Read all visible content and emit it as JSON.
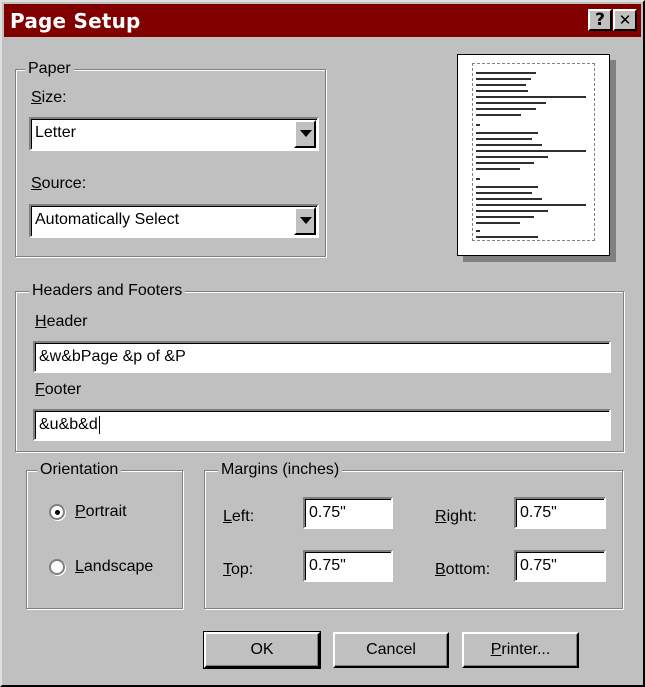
{
  "window": {
    "title": "Page Setup",
    "help_glyph": "?",
    "close_glyph": "✕"
  },
  "paper": {
    "legend": "Paper",
    "size_label": "Size:",
    "size_value": "Letter",
    "source_label": "Source:",
    "source_value": "Automatically Select"
  },
  "headers_footers": {
    "legend": "Headers and Footers",
    "header_label": "Header",
    "header_value": "&w&bPage &p of &P",
    "footer_label": "Footer",
    "footer_value": "&u&b&d"
  },
  "orientation": {
    "legend": "Orientation",
    "portrait_label": "Portrait",
    "landscape_label": "Landscape",
    "selected": "Portrait"
  },
  "margins": {
    "legend": "Margins (inches)",
    "left_label": "Left:",
    "left_value": "0.75\"",
    "right_label": "Right:",
    "right_value": "0.75\"",
    "top_label": "Top:",
    "top_value": "0.75\"",
    "bottom_label": "Bottom:",
    "bottom_value": "0.75\""
  },
  "buttons": {
    "ok": "OK",
    "cancel": "Cancel",
    "printer": "Printer..."
  }
}
